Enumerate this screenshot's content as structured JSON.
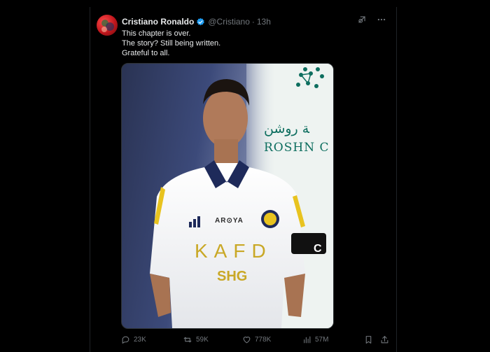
{
  "tweet": {
    "author_name": "Cristiano Ronaldo",
    "handle": "@Cristiano",
    "separator": "·",
    "time": "13h",
    "lines": [
      "This chapter is over.",
      "The story? Still being written.",
      "Grateful to all."
    ],
    "verified_color": "#1d9bf0"
  },
  "media": {
    "background_text_arabic": "ﺔ روشن",
    "background_text_latin": "ROSHN C",
    "shirt_sponsor_top": "AR⊙YA",
    "shirt_sponsor_main": "KAFD",
    "shirt_sponsor_secondary": "SHG",
    "captain_band": "C"
  },
  "actions": {
    "replies": "23K",
    "reposts": "59K",
    "likes": "778K",
    "views": "57M"
  },
  "icons": {
    "header": [
      "grok-icon",
      "more-icon"
    ],
    "actions": [
      "reply-icon",
      "repost-icon",
      "like-icon",
      "views-icon",
      "bookmark-icon",
      "share-icon"
    ]
  }
}
